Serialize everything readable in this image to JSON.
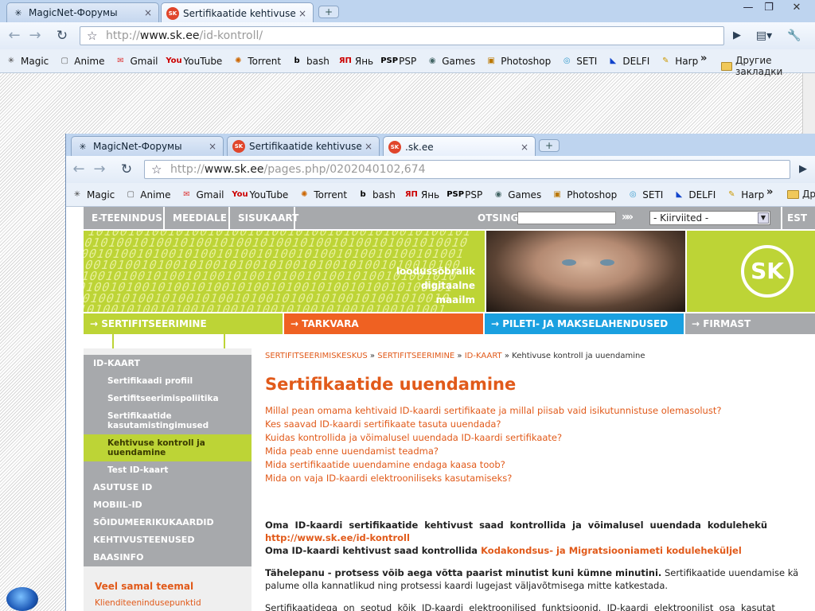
{
  "outer": {
    "tabs": [
      {
        "label": "MagicNet-Форумы",
        "icon": "✳",
        "close": "×"
      },
      {
        "label": "Sertifikaatide kehtivuse ko...",
        "icon": "SK",
        "close": "×"
      }
    ],
    "new_tab": "+",
    "url_domain": "www.sk.ee",
    "url_path": "/id-kontroll/",
    "url_prefix": "http://",
    "window_buttons": {
      "minimize": "—",
      "maximize": "❐",
      "close": "✕"
    },
    "other_bookmarks": "Другие закладки"
  },
  "bookmarks": [
    {
      "label": "Magic",
      "icon": "✳",
      "color": "#444"
    },
    {
      "label": "Anime",
      "icon": "▢",
      "color": "#666"
    },
    {
      "label": "Gmail",
      "icon": "✉",
      "color": "#d33"
    },
    {
      "label": "YouTube",
      "icon": "You",
      "color": "#c00"
    },
    {
      "label": "Torrent",
      "icon": "✺",
      "color": "#c60"
    },
    {
      "label": "bash",
      "icon": "b",
      "color": "#000"
    },
    {
      "label": "Янь",
      "icon": "ЯП",
      "color": "#c00"
    },
    {
      "label": "PSP",
      "icon": "PSP",
      "color": "#000"
    },
    {
      "label": "Games",
      "icon": "◉",
      "color": "#466"
    },
    {
      "label": "Photoshop",
      "icon": "▣",
      "color": "#b70"
    },
    {
      "label": "SETI",
      "icon": "◎",
      "color": "#39c"
    },
    {
      "label": "DELFI",
      "icon": "◣",
      "color": "#14c"
    },
    {
      "label": "Harp",
      "icon": "✎",
      "color": "#c90"
    }
  ],
  "inner": {
    "tabs": [
      {
        "label": "MagicNet-Форумы",
        "icon": "✳",
        "close": "×"
      },
      {
        "label": "Sertifikaatide kehtivuse ko...",
        "icon": "SK",
        "close": "×"
      },
      {
        "label": ".sk.ee",
        "icon": "SK",
        "close": "×"
      }
    ],
    "url_prefix": "http://",
    "url_domain": "www.sk.ee",
    "url_path": "/pages.php/0202040102,674",
    "other_bookmarks": "Др"
  },
  "site": {
    "topnav": [
      "E-TEENINDUS",
      "MEEDIALE",
      "SISUKAART"
    ],
    "search_label": "OTSING",
    "quick_select": "- Kiirviited -",
    "lang": "EST",
    "slogan": [
      "loodussõbralik",
      "digitaalne",
      "maailm"
    ],
    "logo": "SK",
    "categories": [
      {
        "label": "→ SERTIFITSEERIMINE",
        "color": "#bdd436"
      },
      {
        "label": "→ TARKVARA",
        "color": "#ef6122"
      },
      {
        "label": "→ PILETI- JA MAKSELAHENDUSED",
        "color": "#1aa0e0"
      },
      {
        "label": "→ FIRMAST",
        "color": "#a7a9ac"
      }
    ],
    "left_menu": [
      {
        "label": "ID-KAART",
        "sub": false,
        "active": false
      },
      {
        "label": "Sertifikaadi profiil",
        "sub": true,
        "active": false
      },
      {
        "label": "Sertifitseerimispoliitika",
        "sub": true,
        "active": false
      },
      {
        "label": "Sertifikaatide kasutamistingimused",
        "sub": true,
        "active": false
      },
      {
        "label": "Kehtivuse kontroll ja uuendamine",
        "sub": true,
        "active": true
      },
      {
        "label": "Test ID-kaart",
        "sub": true,
        "active": false
      },
      {
        "label": "ASUTUSE ID",
        "sub": false,
        "active": false
      },
      {
        "label": "MOBIIL-ID",
        "sub": false,
        "active": false
      },
      {
        "label": "SÕIDUMEERIKUKAARDID",
        "sub": false,
        "active": false
      },
      {
        "label": "KEHTIVUSTEENUSED",
        "sub": false,
        "active": false
      },
      {
        "label": "BAASINFO",
        "sub": false,
        "active": false
      }
    ],
    "see_also_title": "Veel samal teemal",
    "see_also_link": "Klienditeenindusepunktid",
    "breadcrumb": {
      "a1": "SERTIFITSEERIMISKESKUS",
      "a2": "SERTIFITSEERIMINE",
      "a3": "ID-KAART",
      "sep": " » ",
      "current": "Kehtivuse kontroll ja uuendamine"
    },
    "title": "Sertifikaatide uuendamine",
    "questions": [
      "Millal pean omama kehtivaid ID-kaardi sertifikaate ja millal piisab vaid isikutunnistuse olemasolust?",
      "Kes saavad ID-kaardi sertifikaate tasuta uuendada?",
      "Kuidas kontrollida ja võimalusel uuendada ID-kaardi sertifikaate?",
      "Mida peab enne uuendamist teadma?",
      "Mida sertifikaatide uuendamine endaga kaasa toob?",
      "Mida on vaja ID-kaardi elektrooniliseks kasutamiseks?"
    ],
    "p1_text": "Oma  ID-kaardi  sertifikaatide  kehtivust  saad  kontrollida  ja  võimalusel  uuendada  kodulehekü",
    "p1_link": "http://www.sk.ee/id-kontroll",
    "p2_text": "Oma ID-kaardi kehtivust saad kontrollida ",
    "p2_link": "Kodakondsus- ja Migratsiooniameti koduleheküljel",
    "p3_bold": "Tähelepanu - protsess võib aega võtta paarist minutist kuni kümne minutini.",
    "p3_rest": " Sertifikaatide uuendamise kä",
    "p3_line2": "palume olla kannatlikud ning protsessi kaardi lugejast väljavõtmisega mitte katkestada.",
    "p4": "Sertifikaatidega  on  seotud  kõik  ID-kaardi  elektroonilised  funktsioonid.  ID-kaardi  elektroonilist  osa  kasutat"
  }
}
